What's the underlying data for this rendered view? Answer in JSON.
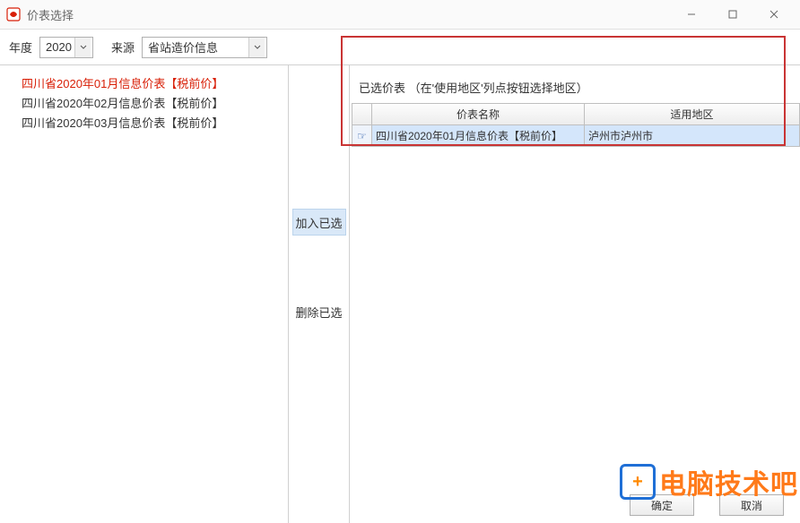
{
  "window": {
    "title": "价表选择"
  },
  "toolbar": {
    "year_label": "年度",
    "year_value": "2020",
    "source_label": "来源",
    "source_value": "省站造价信息"
  },
  "left_list": {
    "items": [
      {
        "label": "四川省2020年01月信息价表【税前价】",
        "selected": true
      },
      {
        "label": "四川省2020年02月信息价表【税前价】",
        "selected": false
      },
      {
        "label": "四川省2020年03月信息价表【税前价】",
        "selected": false
      }
    ]
  },
  "mid": {
    "add_label": "加入已选",
    "remove_label": "删除已选"
  },
  "right": {
    "section_title": "已选价表 （在'使用地区'列点按钮选择地区）",
    "columns": {
      "name": "价表名称",
      "region": "适用地区"
    },
    "rows": [
      {
        "name": "四川省2020年01月信息价表【税前价】",
        "region": "泸州市泸州市"
      }
    ]
  },
  "footer": {
    "ok": "确定",
    "cancel": "取消"
  },
  "watermark": {
    "text": "电脑技术吧"
  }
}
